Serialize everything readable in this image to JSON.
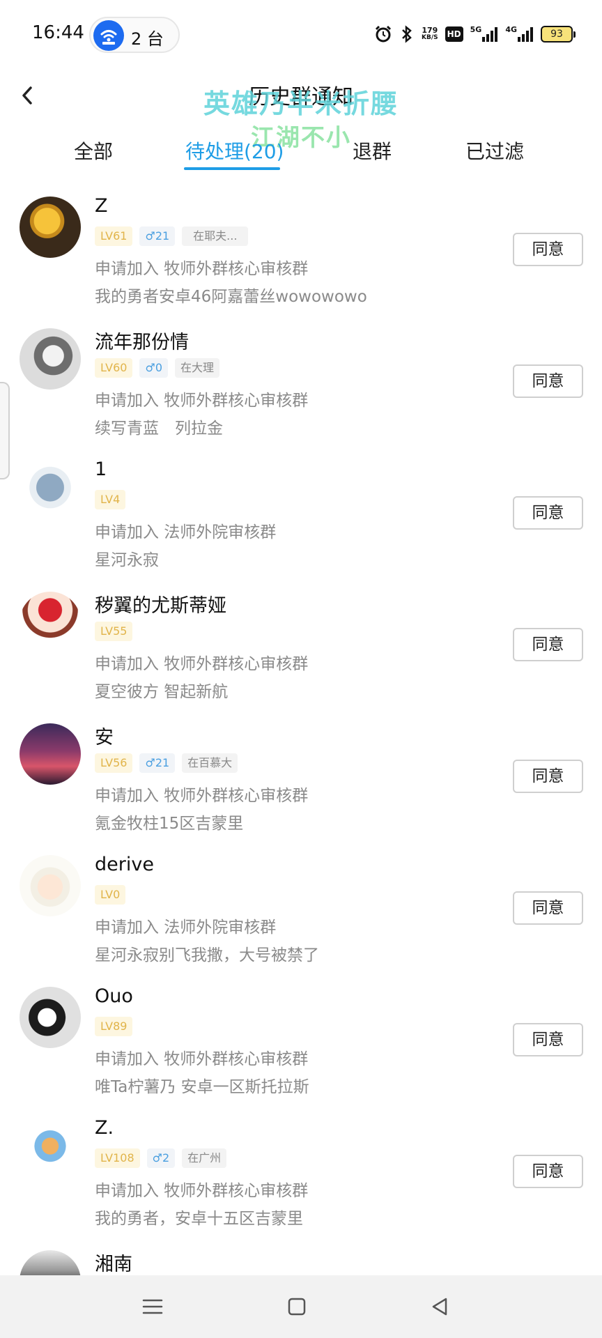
{
  "status_bar": {
    "time": "16:44",
    "hotspot_count": "2 台",
    "net_speed": "179",
    "net_unit": "KB/S",
    "hd_label": "HD",
    "net1": "5G",
    "net2": "4G",
    "battery": "93",
    "icons": [
      "alarm-icon",
      "bluetooth-icon",
      "signal-icon",
      "battery-icon"
    ]
  },
  "header": {
    "title": "历史群通知",
    "overlay_line1": "英雄乃半米折腰",
    "overlay_line2": "江湖不小"
  },
  "tabs": [
    {
      "label": "全部"
    },
    {
      "label": "待处理(20)"
    },
    {
      "label": "退群"
    },
    {
      "label": "已过滤"
    }
  ],
  "active_tab": 1,
  "agree_label": "同意",
  "items": [
    {
      "name": "Z",
      "level": "LV61",
      "gender_age": "♂21",
      "location": "在耶夫...",
      "request": "申请加入 牧师外群核心审核群",
      "message": "我的勇者安卓46阿嘉蕾丝wowowowo"
    },
    {
      "name": "流年那份情",
      "level": "LV60",
      "gender_age": "♂0",
      "location": "在大理",
      "request": "申请加入 牧师外群核心审核群",
      "message": "续写青蓝　列拉金"
    },
    {
      "name": "1",
      "level": "LV4",
      "request": "申请加入 法师外院审核群",
      "message": "星河永寂"
    },
    {
      "name": "秽翼的尤斯蒂娅",
      "level": "LV55",
      "request": "申请加入 牧师外群核心审核群",
      "message": "夏空彼方 智起新航"
    },
    {
      "name": "安",
      "level": "LV56",
      "gender_age": "♂21",
      "location": "在百慕大",
      "request": "申请加入 牧师外群核心审核群",
      "message": "氪金牧柱15区吉蒙里"
    },
    {
      "name": "derive",
      "level": "LV0",
      "request": "申请加入 法师外院审核群",
      "message": "星河永寂别飞我撒，大号被禁了"
    },
    {
      "name": "Ouo",
      "level": "LV89",
      "request": "申请加入 牧师外群核心审核群",
      "message": "唯Ta柠薯乃  安卓一区斯托拉斯"
    },
    {
      "name": "Z.",
      "level": "LV108",
      "gender_age": "♂2",
      "location": "在广州",
      "request": "申请加入 牧师外群核心审核群",
      "message": "我的勇者，安卓十五区吉蒙里"
    },
    {
      "name": "湘南"
    }
  ]
}
